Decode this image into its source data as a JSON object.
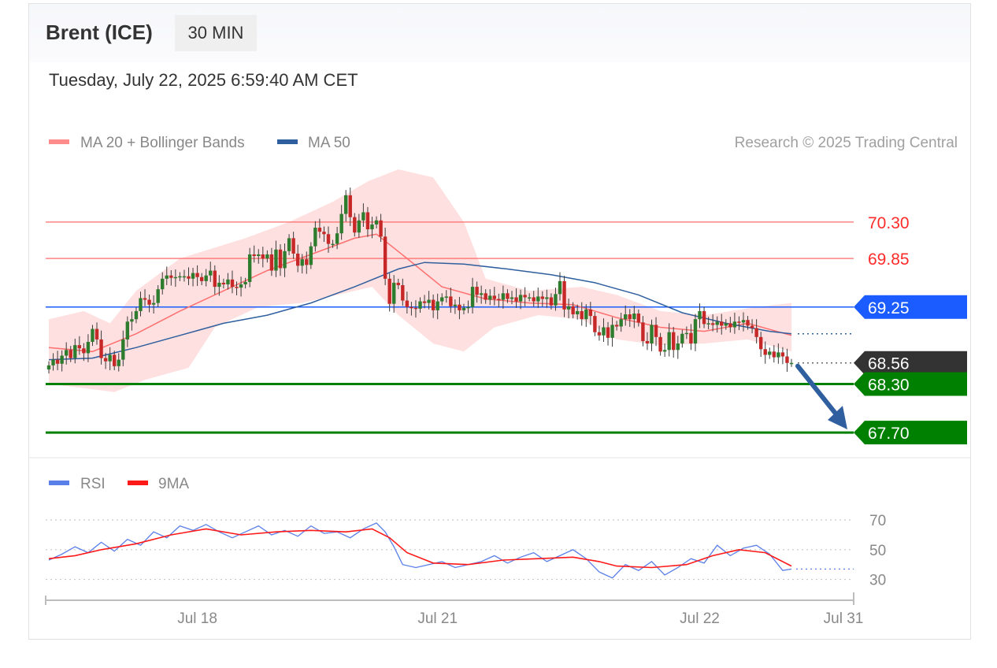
{
  "header": {
    "title": "Brent (ICE)",
    "timeframe": "30 MIN",
    "datetime": "Tuesday, July 22, 2025 6:59:40 AM CET"
  },
  "legend": {
    "ma20_label": "MA 20 + Bollinger Bands",
    "ma50_label": "MA 50",
    "copyright": "Research © 2025 Trading Central",
    "rsi_label": "RSI",
    "rsi_ma_label": "9MA"
  },
  "colors": {
    "resistance": "#ff5c5c",
    "pivot": "#1a5cff",
    "support": "#008000",
    "last_price": "#333333",
    "ma20": "#ff6f6f",
    "ma50": "#2f5f9e",
    "band_fill": "#ffd6d6",
    "candle_up": "#2e7d2e",
    "candle_down": "#c62828",
    "rsi": "#5b7fe8",
    "rsi_ma": "#ff1a1a",
    "arrow": "#2f5f9e"
  },
  "chart_data": [
    {
      "type": "candlestick",
      "ylim": [
        67.4,
        70.95
      ],
      "xlim": [
        0,
        170
      ],
      "x_ticks": [
        {
          "label": "Jul 18",
          "x": 34
        },
        {
          "label": "Jul 21",
          "x": 89
        },
        {
          "label": "Jul 22",
          "x": 149
        },
        {
          "label": "Jul 31",
          "x": 172
        }
      ],
      "levels": [
        {
          "label": "70.30",
          "value": 70.3,
          "kind": "resistance"
        },
        {
          "label": "69.85",
          "value": 69.85,
          "kind": "resistance"
        },
        {
          "label": "69.25",
          "value": 69.25,
          "kind": "pivot"
        },
        {
          "label": "68.56",
          "value": 68.56,
          "kind": "last"
        },
        {
          "label": "68.30",
          "value": 68.3,
          "kind": "support"
        },
        {
          "label": "67.70",
          "value": 67.7,
          "kind": "support"
        }
      ],
      "close": [
        68.53,
        68.6,
        68.55,
        68.65,
        68.72,
        68.62,
        68.78,
        68.74,
        68.68,
        68.82,
        68.98,
        68.85,
        68.62,
        68.58,
        68.66,
        68.52,
        68.6,
        68.85,
        69.07,
        69.1,
        69.2,
        69.36,
        69.34,
        69.28,
        69.3,
        69.47,
        69.6,
        69.64,
        69.61,
        69.62,
        69.63,
        69.63,
        69.6,
        69.67,
        69.62,
        69.57,
        69.64,
        69.7,
        69.5,
        69.55,
        69.53,
        69.59,
        69.5,
        69.49,
        69.53,
        69.56,
        69.9,
        69.88,
        69.9,
        69.85,
        69.9,
        69.7,
        69.96,
        69.73,
        69.94,
        70.1,
        69.91,
        69.76,
        69.84,
        69.77,
        70.0,
        70.23,
        70.18,
        70.15,
        70.03,
        70.03,
        70.16,
        70.4,
        70.63,
        70.36,
        70.17,
        70.32,
        70.42,
        70.21,
        70.27,
        70.32,
        70.12,
        69.6,
        69.29,
        69.55,
        69.52,
        69.33,
        69.25,
        69.24,
        69.23,
        69.32,
        69.3,
        69.34,
        69.21,
        69.32,
        69.37,
        69.38,
        69.26,
        69.28,
        69.21,
        69.24,
        69.25,
        69.5,
        69.4,
        69.42,
        69.34,
        69.39,
        69.35,
        69.34,
        69.42,
        69.35,
        69.37,
        69.32,
        69.4,
        69.37,
        69.37,
        69.32,
        69.38,
        69.35,
        69.37,
        69.27,
        69.41,
        69.57,
        69.22,
        69.26,
        69.16,
        69.2,
        69.1,
        69.22,
        69.14,
        68.94,
        68.9,
        69.0,
        68.87,
        69.03,
        69.01,
        69.1,
        69.16,
        69.1,
        69.17,
        69.06,
        68.83,
        68.8,
        69.03,
        68.88,
        68.7,
        68.72,
        68.94,
        68.72,
        68.8,
        68.92,
        68.93,
        68.8,
        69.1,
        69.2,
        69.04,
        69.05,
        69.03,
        69.07,
        69.02,
        69.05,
        69.0,
        69.07,
        69.06,
        69.09,
        69.02,
        68.99,
        68.88,
        68.73,
        68.66,
        68.7,
        68.63,
        68.69,
        68.64,
        68.56,
        68.56
      ],
      "ma20": {
        "name": "MA 20 + Bollinger Bands",
        "points": [
          [
            0,
            68.75
          ],
          [
            10,
            68.7
          ],
          [
            20,
            68.92
          ],
          [
            30,
            69.2
          ],
          [
            40,
            69.45
          ],
          [
            50,
            69.7
          ],
          [
            60,
            69.9
          ],
          [
            70,
            70.1
          ],
          [
            75,
            70.15
          ],
          [
            82,
            69.85
          ],
          [
            90,
            69.5
          ],
          [
            100,
            69.35
          ],
          [
            110,
            69.3
          ],
          [
            120,
            69.28
          ],
          [
            130,
            69.12
          ],
          [
            140,
            69.0
          ],
          [
            150,
            68.95
          ],
          [
            160,
            69.05
          ],
          [
            170,
            68.9
          ]
        ]
      },
      "bollinger": {
        "upper": [
          [
            0,
            69.1
          ],
          [
            8,
            69.2
          ],
          [
            14,
            69.05
          ],
          [
            20,
            69.45
          ],
          [
            30,
            69.85
          ],
          [
            36,
            69.95
          ],
          [
            45,
            70.1
          ],
          [
            55,
            70.3
          ],
          [
            65,
            70.55
          ],
          [
            73,
            70.8
          ],
          [
            80,
            70.95
          ],
          [
            88,
            70.85
          ],
          [
            95,
            70.3
          ],
          [
            100,
            69.6
          ],
          [
            110,
            69.45
          ],
          [
            122,
            69.5
          ],
          [
            130,
            69.4
          ],
          [
            140,
            69.2
          ],
          [
            150,
            69.15
          ],
          [
            162,
            69.25
          ],
          [
            170,
            69.3
          ]
        ],
        "lower": [
          [
            0,
            68.3
          ],
          [
            8,
            68.25
          ],
          [
            15,
            68.2
          ],
          [
            22,
            68.35
          ],
          [
            32,
            68.5
          ],
          [
            38,
            69.0
          ],
          [
            48,
            69.25
          ],
          [
            58,
            69.3
          ],
          [
            66,
            69.4
          ],
          [
            74,
            69.5
          ],
          [
            80,
            69.15
          ],
          [
            88,
            68.8
          ],
          [
            95,
            68.7
          ],
          [
            102,
            69.0
          ],
          [
            112,
            69.15
          ],
          [
            122,
            69.1
          ],
          [
            130,
            68.85
          ],
          [
            140,
            68.78
          ],
          [
            150,
            68.8
          ],
          [
            160,
            68.85
          ],
          [
            170,
            68.7
          ]
        ]
      },
      "ma50": {
        "name": "MA 50",
        "points": [
          [
            0,
            68.6
          ],
          [
            10,
            68.62
          ],
          [
            20,
            68.75
          ],
          [
            30,
            68.9
          ],
          [
            40,
            69.05
          ],
          [
            50,
            69.15
          ],
          [
            60,
            69.3
          ],
          [
            70,
            69.5
          ],
          [
            80,
            69.72
          ],
          [
            86,
            69.8
          ],
          [
            95,
            69.78
          ],
          [
            105,
            69.72
          ],
          [
            115,
            69.65
          ],
          [
            125,
            69.55
          ],
          [
            135,
            69.4
          ],
          [
            145,
            69.18
          ],
          [
            155,
            69.05
          ],
          [
            165,
            68.95
          ],
          [
            170,
            68.92
          ]
        ]
      }
    },
    {
      "type": "line",
      "ylim": [
        25,
        78
      ],
      "y_ticks": [
        70,
        50,
        30
      ],
      "series": [
        {
          "name": "RSI",
          "points": [
            [
              0,
              43
            ],
            [
              3,
              47
            ],
            [
              6,
              52
            ],
            [
              9,
              48
            ],
            [
              12,
              55
            ],
            [
              15,
              49
            ],
            [
              18,
              57
            ],
            [
              21,
              53
            ],
            [
              24,
              62
            ],
            [
              27,
              58
            ],
            [
              30,
              66
            ],
            [
              33,
              63
            ],
            [
              36,
              67
            ],
            [
              39,
              62
            ],
            [
              42,
              58
            ],
            [
              45,
              62
            ],
            [
              48,
              66
            ],
            [
              51,
              60
            ],
            [
              54,
              63
            ],
            [
              57,
              59
            ],
            [
              60,
              66
            ],
            [
              63,
              61
            ],
            [
              66,
              62
            ],
            [
              69,
              58
            ],
            [
              72,
              64
            ],
            [
              75,
              68
            ],
            [
              77,
              62
            ],
            [
              79,
              52
            ],
            [
              81,
              40
            ],
            [
              84,
              38
            ],
            [
              87,
              40
            ],
            [
              90,
              42
            ],
            [
              93,
              38
            ],
            [
              96,
              40
            ],
            [
              99,
              42
            ],
            [
              102,
              46
            ],
            [
              105,
              41
            ],
            [
              108,
              45
            ],
            [
              111,
              48
            ],
            [
              114,
              42
            ],
            [
              117,
              46
            ],
            [
              120,
              50
            ],
            [
              123,
              44
            ],
            [
              126,
              35
            ],
            [
              129,
              31
            ],
            [
              132,
              40
            ],
            [
              135,
              36
            ],
            [
              138,
              42
            ],
            [
              141,
              33
            ],
            [
              144,
              38
            ],
            [
              147,
              44
            ],
            [
              150,
              41
            ],
            [
              153,
              53
            ],
            [
              156,
              46
            ],
            [
              159,
              51
            ],
            [
              162,
              53
            ],
            [
              165,
              47
            ],
            [
              168,
              36
            ],
            [
              170,
              37
            ]
          ]
        },
        {
          "name": "9MA",
          "points": [
            [
              0,
              44
            ],
            [
              6,
              46
            ],
            [
              12,
              50
            ],
            [
              20,
              54
            ],
            [
              28,
              60
            ],
            [
              36,
              64
            ],
            [
              44,
              60
            ],
            [
              52,
              62
            ],
            [
              60,
              63
            ],
            [
              68,
              62
            ],
            [
              74,
              64
            ],
            [
              78,
              58
            ],
            [
              82,
              48
            ],
            [
              88,
              41
            ],
            [
              96,
              40
            ],
            [
              104,
              43
            ],
            [
              112,
              44
            ],
            [
              120,
              45
            ],
            [
              126,
              42
            ],
            [
              130,
              39
            ],
            [
              138,
              38
            ],
            [
              146,
              40
            ],
            [
              152,
              46
            ],
            [
              158,
              50
            ],
            [
              164,
              48
            ],
            [
              170,
              39
            ]
          ]
        }
      ]
    }
  ]
}
